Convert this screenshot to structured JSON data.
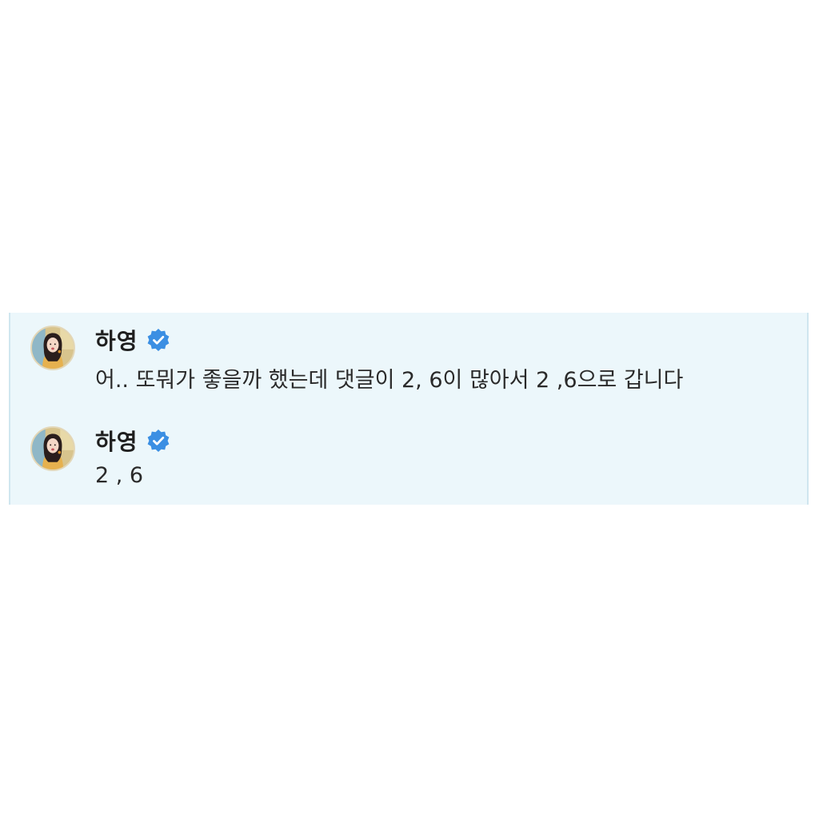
{
  "colors": {
    "panel_background": "#ecf7fb",
    "verified_badge": "#3b8fe3",
    "text": "#2a2a2a"
  },
  "messages": [
    {
      "author": "하영",
      "verified": true,
      "avatar_icon": "avatar-photo-icon",
      "text": "어.. 또뭐가 좋을까 했는데 댓글이 2, 6이 많아서 2 ,6으로 갑니다"
    },
    {
      "author": "하영",
      "verified": true,
      "avatar_icon": "avatar-photo-icon",
      "text": "2 , 6"
    }
  ]
}
